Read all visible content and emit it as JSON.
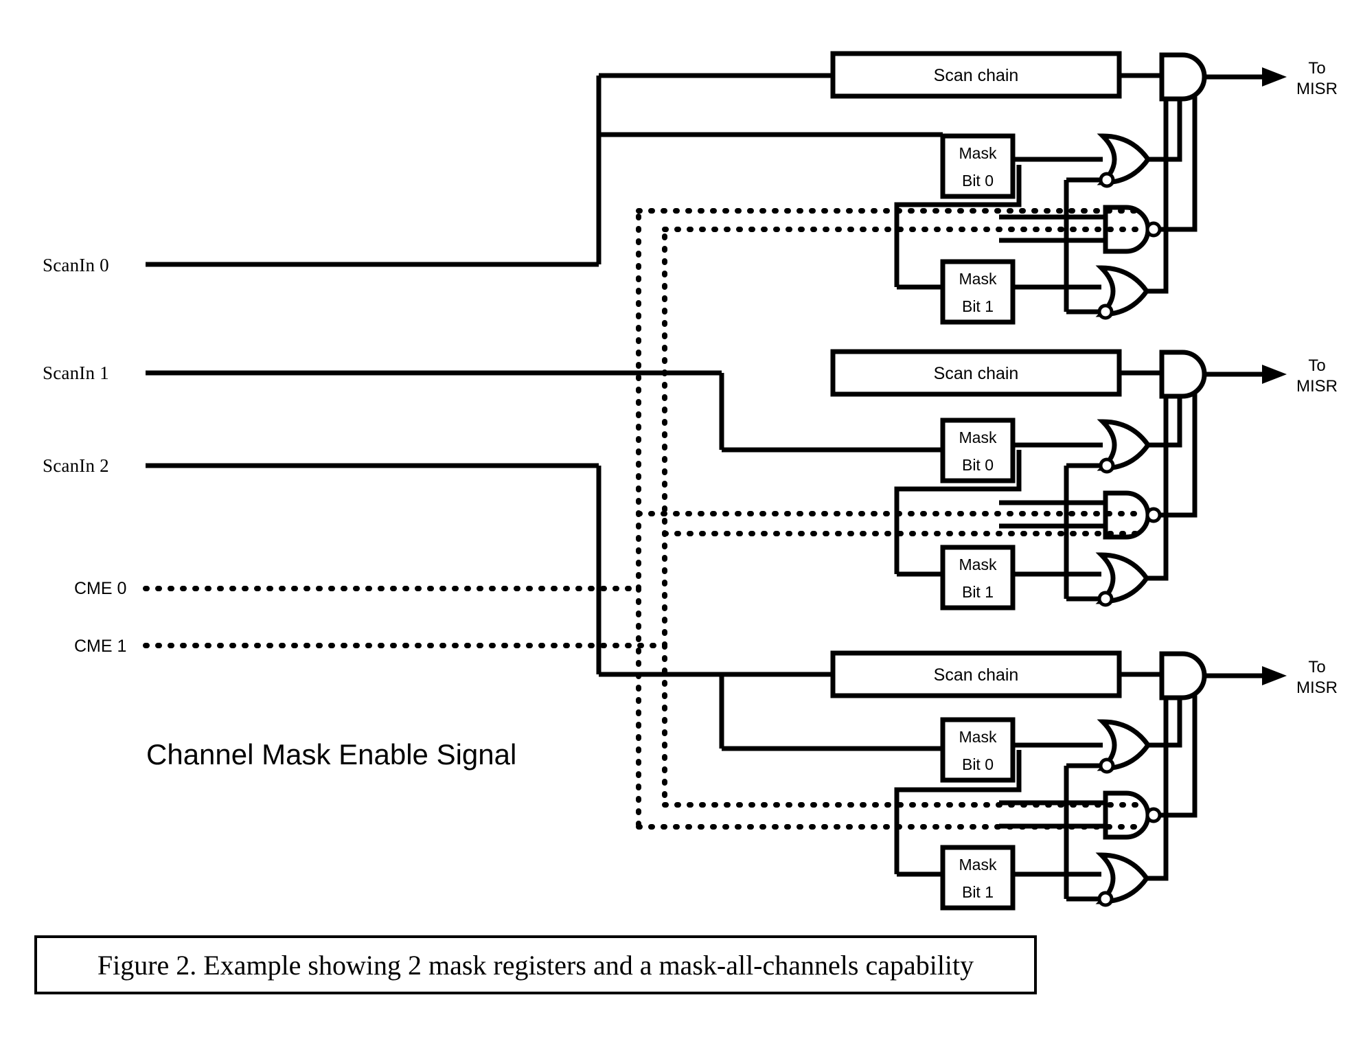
{
  "figure": {
    "caption": "Figure 2. Example showing 2 mask registers and a mask-all-channels capability",
    "annotation": "Channel Mask Enable Signal"
  },
  "inputs": [
    {
      "id": "scanin0",
      "label": "ScanIn 0",
      "type": "solid"
    },
    {
      "id": "scanin1",
      "label": "ScanIn 1",
      "type": "solid"
    },
    {
      "id": "scanin2",
      "label": "ScanIn 2",
      "type": "solid"
    },
    {
      "id": "cme0",
      "label": "CME 0",
      "type": "dotted"
    },
    {
      "id": "cme1",
      "label": "CME 1",
      "type": "dotted"
    }
  ],
  "channels": [
    {
      "index": 0,
      "scan_chain_label": "Scan chain",
      "mask_bit0_line1": "Mask",
      "mask_bit0_line2": "Bit 0",
      "mask_bit1_line1": "Mask",
      "mask_bit1_line2": "Bit 1",
      "output_line1": "To",
      "output_line2": "MISR",
      "gates": [
        "nor-gate",
        "nand-gate",
        "nor-gate",
        "and-gate"
      ]
    },
    {
      "index": 1,
      "scan_chain_label": "Scan chain",
      "mask_bit0_line1": "Mask",
      "mask_bit0_line2": "Bit 0",
      "mask_bit1_line1": "Mask",
      "mask_bit1_line2": "Bit 1",
      "output_line1": "To",
      "output_line2": "MISR",
      "gates": [
        "nor-gate",
        "nand-gate",
        "nor-gate",
        "and-gate"
      ]
    },
    {
      "index": 2,
      "scan_chain_label": "Scan chain",
      "mask_bit0_line1": "Mask",
      "mask_bit0_line2": "Bit 0",
      "mask_bit1_line1": "Mask",
      "mask_bit1_line2": "Bit 1",
      "output_line1": "To",
      "output_line2": "MISR",
      "gates": [
        "nor-gate",
        "nand-gate",
        "nor-gate",
        "and-gate"
      ]
    }
  ],
  "colors": {
    "ink": "#000000",
    "paper": "#ffffff"
  }
}
